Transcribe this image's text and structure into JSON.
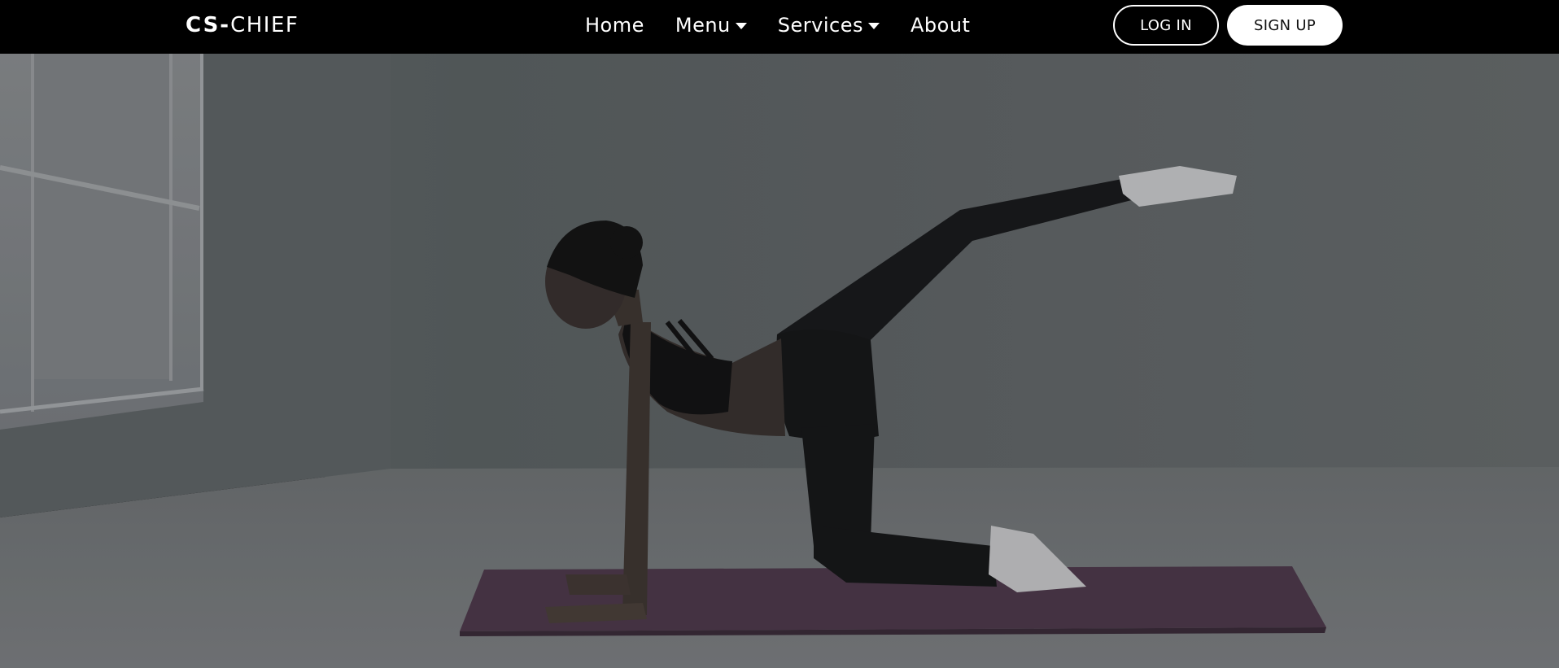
{
  "brand": {
    "logo_bold": "CS-",
    "logo_light": "CHIEF"
  },
  "nav": {
    "items": [
      {
        "label": "Home",
        "has_dropdown": false
      },
      {
        "label": "Menu",
        "has_dropdown": true
      },
      {
        "label": "Services",
        "has_dropdown": true
      },
      {
        "label": "About",
        "has_dropdown": false
      }
    ]
  },
  "auth": {
    "login_label": "LOG IN",
    "signup_label": "SIGN UP"
  },
  "hero": {
    "image": "woman-doing-yoga-on-mat-photo",
    "colors": {
      "wall": "#5e6466",
      "floor": "#7a7d80",
      "mat": "#4e3a4c",
      "overlay": "#000000"
    }
  }
}
